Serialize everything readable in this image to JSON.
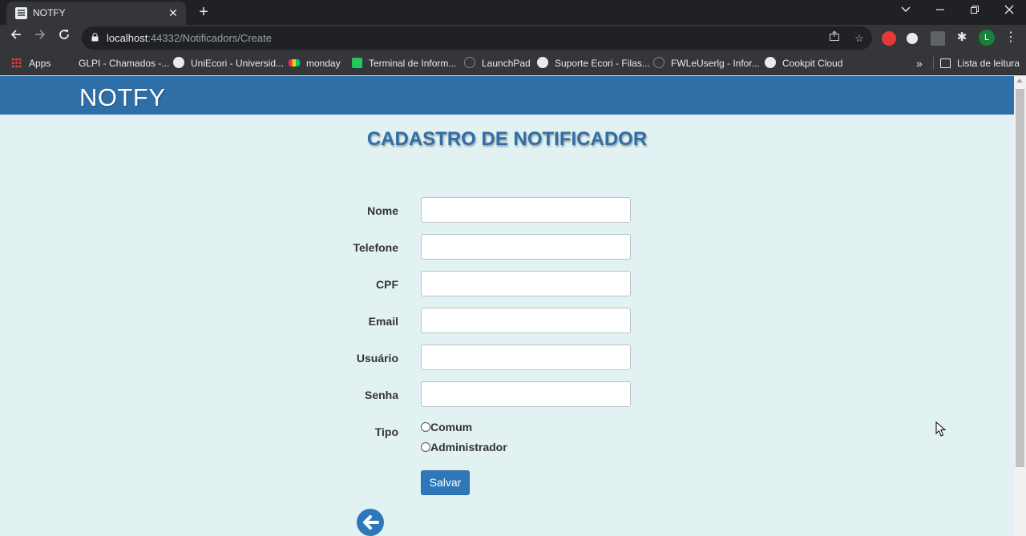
{
  "browser": {
    "tab_title": "NOTFY",
    "url_host": "localhost",
    "url_rest": ":44332/Notificadors/Create",
    "bookmarks": [
      {
        "label": "Apps",
        "icon": "apps-grid-icon"
      },
      {
        "label": "GLPI - Chamados -...",
        "icon": "glpi-icon"
      },
      {
        "label": "UniEcori - Universid...",
        "icon": "globe-icon"
      },
      {
        "label": "monday",
        "icon": "monday-icon"
      },
      {
        "label": "Terminal de Inform...",
        "icon": "trello-icon"
      },
      {
        "label": "LaunchPad",
        "icon": "globe-icon"
      },
      {
        "label": "Suporte Ecori - Filas...",
        "icon": "globe-icon"
      },
      {
        "label": "FWLeUserlg - Infor...",
        "icon": "globe-icon"
      },
      {
        "label": "Cookpit Cloud",
        "icon": "globe-icon"
      }
    ],
    "reading_list": "Lista de leitura",
    "profile_initial": "L"
  },
  "app": {
    "brand": "NOTFY",
    "title": "CADASTRO DE NOTIFICADOR",
    "fields": [
      {
        "label": "Nome",
        "value": ""
      },
      {
        "label": "Telefone",
        "value": ""
      },
      {
        "label": "CPF",
        "value": ""
      },
      {
        "label": "Email",
        "value": ""
      },
      {
        "label": "Usuário",
        "value": ""
      },
      {
        "label": "Senha",
        "value": ""
      }
    ],
    "tipo_label": "Tipo",
    "tipo_options": [
      "Comum",
      "Administrador"
    ],
    "save_label": "Salvar"
  },
  "colors": {
    "navbar": "#2e6fa7",
    "page_bg": "#e2f1f2",
    "button": "#2e77b8"
  }
}
